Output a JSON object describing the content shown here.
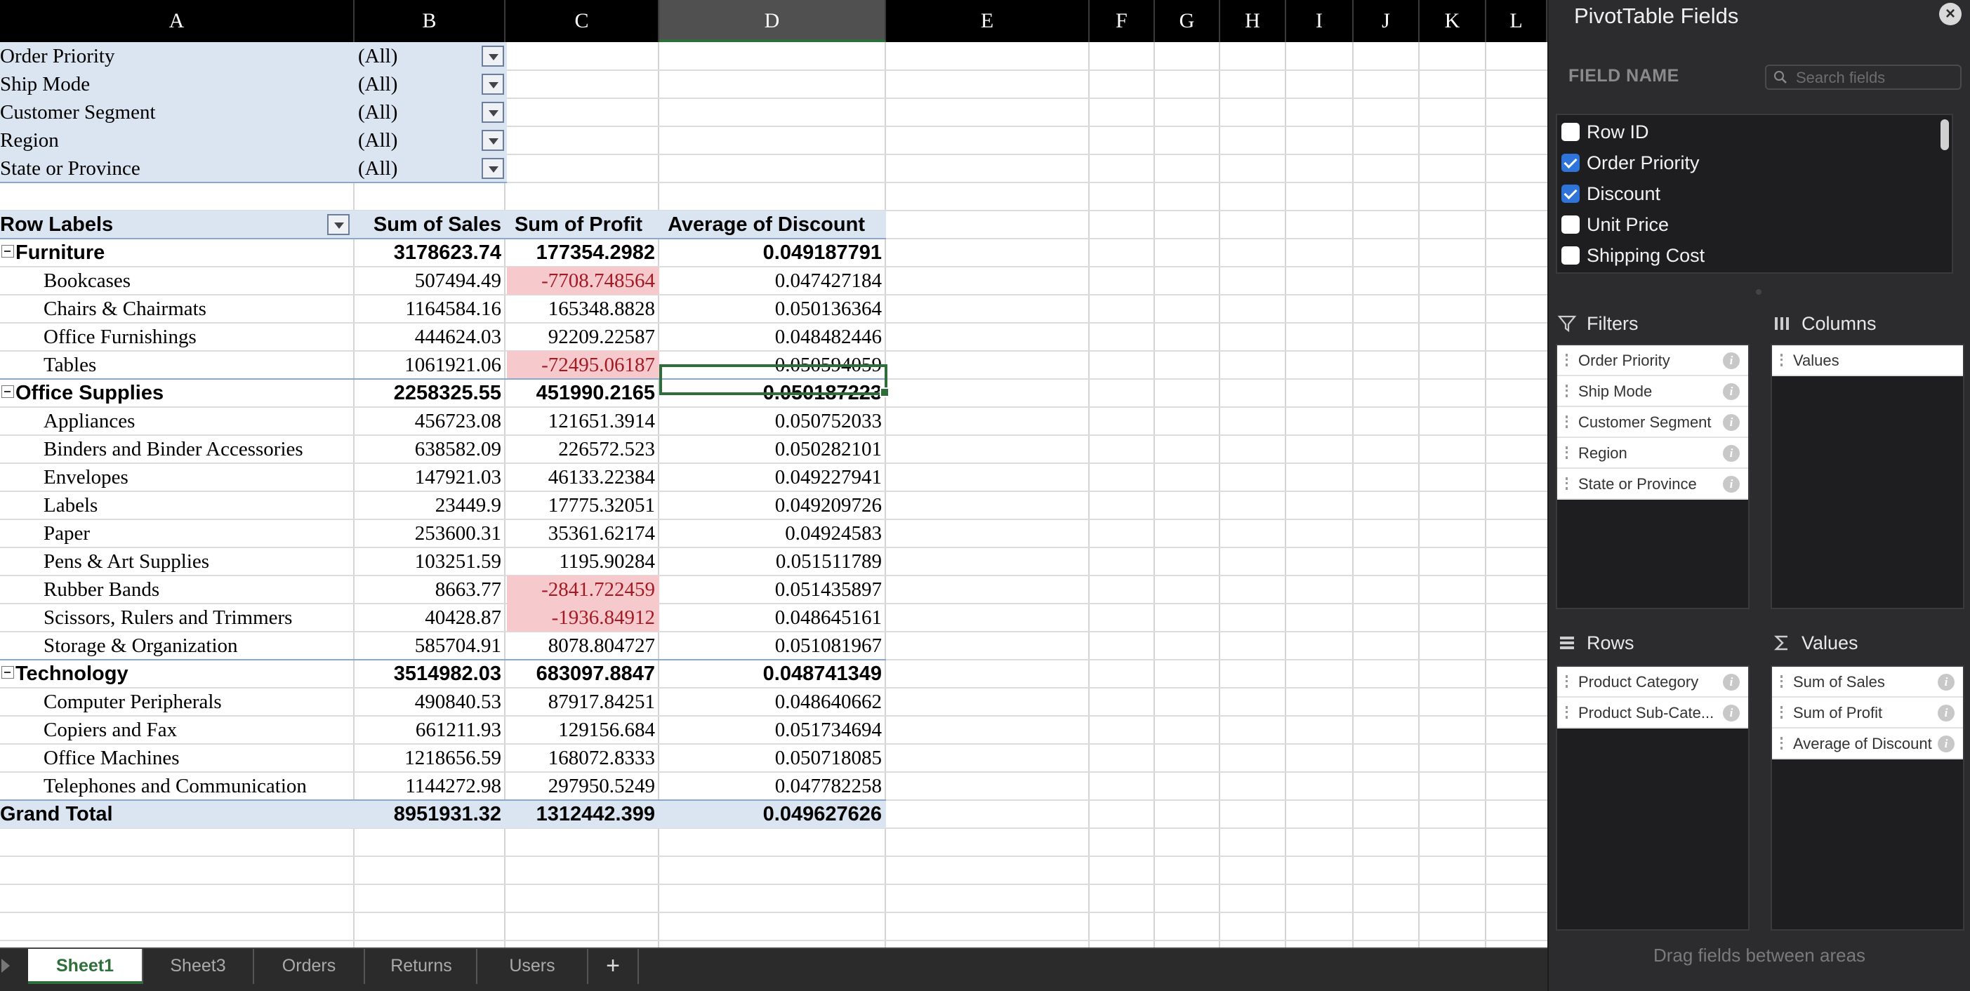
{
  "columns": [
    "A",
    "B",
    "C",
    "D",
    "E",
    "F",
    "G",
    "H",
    "I",
    "J",
    "K",
    "L"
  ],
  "selected_column": "D",
  "filters": [
    {
      "field": "Order Priority",
      "value": "(All)"
    },
    {
      "field": "Ship Mode",
      "value": "(All)"
    },
    {
      "field": "Customer Segment",
      "value": "(All)"
    },
    {
      "field": "Region",
      "value": "(All)"
    },
    {
      "field": "State or Province",
      "value": "(All)"
    }
  ],
  "pivot": {
    "headers": {
      "row_labels": "Row Labels",
      "sales": "Sum of Sales",
      "profit": "Sum of Profit",
      "discount": "Average of Discount"
    },
    "rows": [
      {
        "type": "group",
        "label": "Furniture",
        "sales": "3178623.74",
        "profit": "177354.2982",
        "discount": "0.049187791"
      },
      {
        "type": "item",
        "label": "Bookcases",
        "sales": "507494.49",
        "profit": "-7708.748564",
        "discount": "0.047427184",
        "neg": true
      },
      {
        "type": "item",
        "label": "Chairs & Chairmats",
        "sales": "1164584.16",
        "profit": "165348.8828",
        "discount": "0.050136364"
      },
      {
        "type": "item",
        "label": "Office Furnishings",
        "sales": "444624.03",
        "profit": "92209.22587",
        "discount": "0.048482446"
      },
      {
        "type": "item",
        "label": "Tables",
        "sales": "1061921.06",
        "profit": "-72495.06187",
        "discount": "0.050594059",
        "neg": true
      },
      {
        "type": "group",
        "label": "Office Supplies",
        "sales": "2258325.55",
        "profit": "451990.2165",
        "discount": "0.050187223"
      },
      {
        "type": "item",
        "label": "Appliances",
        "sales": "456723.08",
        "profit": "121651.3914",
        "discount": "0.050752033"
      },
      {
        "type": "item",
        "label": "Binders and Binder Accessories",
        "sales": "638582.09",
        "profit": "226572.523",
        "discount": "0.050282101"
      },
      {
        "type": "item",
        "label": "Envelopes",
        "sales": "147921.03",
        "profit": "46133.22384",
        "discount": "0.049227941"
      },
      {
        "type": "item",
        "label": "Labels",
        "sales": "23449.9",
        "profit": "17775.32051",
        "discount": "0.049209726"
      },
      {
        "type": "item",
        "label": "Paper",
        "sales": "253600.31",
        "profit": "35361.62174",
        "discount": "0.04924583"
      },
      {
        "type": "item",
        "label": "Pens & Art Supplies",
        "sales": "103251.59",
        "profit": "1195.90284",
        "discount": "0.051511789"
      },
      {
        "type": "item",
        "label": "Rubber Bands",
        "sales": "8663.77",
        "profit": "-2841.722459",
        "discount": "0.051435897",
        "neg": true
      },
      {
        "type": "item",
        "label": "Scissors, Rulers and Trimmers",
        "sales": "40428.87",
        "profit": "-1936.84912",
        "discount": "0.048645161",
        "neg": true
      },
      {
        "type": "item",
        "label": "Storage & Organization",
        "sales": "585704.91",
        "profit": "8078.804727",
        "discount": "0.051081967"
      },
      {
        "type": "group",
        "label": "Technology",
        "sales": "3514982.03",
        "profit": "683097.8847",
        "discount": "0.048741349"
      },
      {
        "type": "item",
        "label": "Computer Peripherals",
        "sales": "490840.53",
        "profit": "87917.84251",
        "discount": "0.048640662"
      },
      {
        "type": "item",
        "label": "Copiers and Fax",
        "sales": "661211.93",
        "profit": "129156.684",
        "discount": "0.051734694"
      },
      {
        "type": "item",
        "label": "Office Machines",
        "sales": "1218656.59",
        "profit": "168072.8333",
        "discount": "0.050718085"
      },
      {
        "type": "item",
        "label": "Telephones and Communication",
        "sales": "1144272.98",
        "profit": "297950.5249",
        "discount": "0.047782258"
      }
    ],
    "grand_total": {
      "label": "Grand Total",
      "sales": "8951931.32",
      "profit": "1312442.399",
      "discount": "0.049627626"
    }
  },
  "sheet_tabs": [
    "Sheet1",
    "Sheet3",
    "Orders",
    "Returns",
    "Users"
  ],
  "active_tab": "Sheet1",
  "add_tab_label": "+",
  "panel": {
    "title": "PivotTable Fields",
    "close_label": "×",
    "field_name_label": "FIELD NAME",
    "search_placeholder": "Search fields",
    "fields": [
      {
        "label": "Row ID",
        "checked": false
      },
      {
        "label": "Order Priority",
        "checked": true
      },
      {
        "label": "Discount",
        "checked": true
      },
      {
        "label": "Unit Price",
        "checked": false
      },
      {
        "label": "Shipping Cost",
        "checked": false
      }
    ],
    "filters_label": "Filters",
    "columns_label": "Columns",
    "rows_label": "Rows",
    "values_label": "Values",
    "filter_items": [
      "Order Priority",
      "Ship Mode",
      "Customer Segment",
      "Region",
      "State or Province"
    ],
    "column_items": [
      "Values"
    ],
    "row_items": [
      "Product Category",
      "Product Sub-Cate..."
    ],
    "value_items": [
      "Sum of Sales",
      "Sum of Profit",
      "Average of Discount"
    ],
    "info_glyph": "i",
    "drag_hint": "Drag fields between areas"
  },
  "colors": {
    "accent": "#2e6e3b",
    "pivot_header_bg": "#dbe5f1",
    "negative_bg": "#f6c9cc",
    "negative_text": "#a11b25",
    "checkbox_blue": "#2f74d9"
  }
}
